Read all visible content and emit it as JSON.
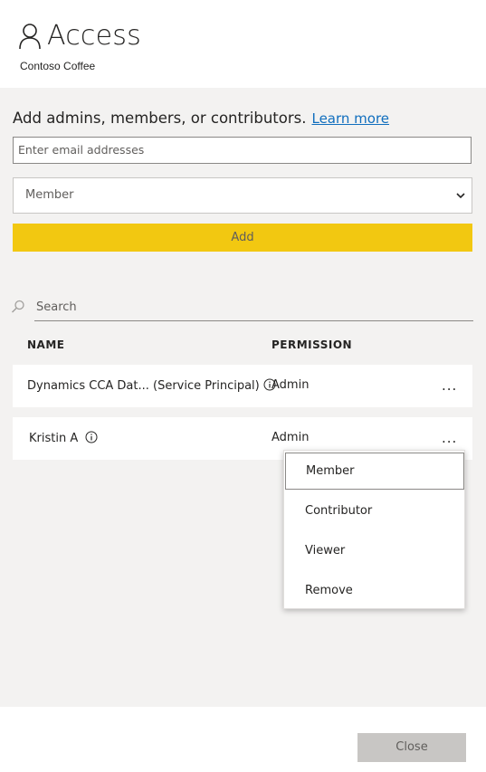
{
  "header": {
    "title": "Access",
    "subtitle": "Contoso Coffee",
    "icon": "person-icon"
  },
  "add_section": {
    "heading": "Add admins, members, or contributors.",
    "learn_more": "Learn more",
    "email_placeholder": "Enter email addresses",
    "role_selected": "Member",
    "add_button": "Add",
    "accent_color": "#f2c811"
  },
  "search": {
    "placeholder": "Search"
  },
  "table": {
    "headers": {
      "name": "NAME",
      "permission": "PERMISSION"
    },
    "rows": [
      {
        "name": "Dynamics CCA Dat...  (Service Principal)",
        "permission": "Admin",
        "more": "..."
      },
      {
        "name": "Kristin A",
        "permission": "Admin",
        "more": "..."
      }
    ]
  },
  "context_menu": {
    "items": [
      "Member",
      "Contributor",
      "Viewer",
      "Remove"
    ],
    "selected": "Member"
  },
  "footer": {
    "close_button": "Close"
  }
}
